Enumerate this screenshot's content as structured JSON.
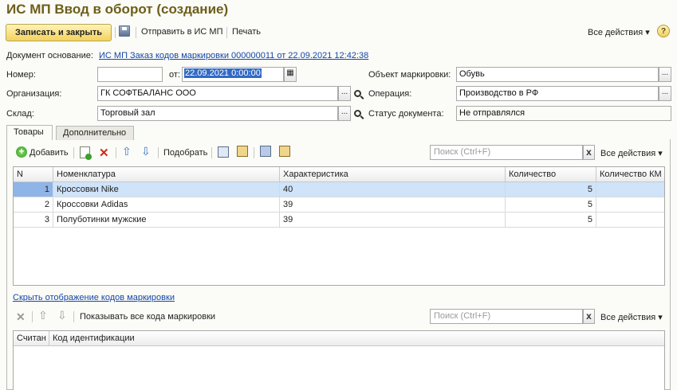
{
  "window": {
    "title": "ИС МП Ввод в оборот (создание)"
  },
  "toolbar": {
    "save_close": "Записать и закрыть",
    "send": "Отправить в ИС МП",
    "print": "Печать",
    "all_actions": "Все действия",
    "help": "?"
  },
  "header": {
    "basis_label": "Документ основание:",
    "basis_link": "ИС МП Заказ кодов маркировки 000000011 от 22.09.2021 12:42:38",
    "number_label": "Номер:",
    "number_value": "",
    "date_label": "от:",
    "date_value": "22.09.2021  0:00:00",
    "object_label": "Объект маркировки:",
    "object_value": "Обувь",
    "org_label": "Организация:",
    "org_value": "ГК СОФТБАЛАНС ООО",
    "operation_label": "Операция:",
    "operation_value": "Производство в РФ",
    "warehouse_label": "Склад:",
    "warehouse_value": "Торговый зал",
    "status_label": "Статус документа:",
    "status_value": "Не отправлялся",
    "select_glyph": "..."
  },
  "tabs": [
    {
      "label": "Товары"
    },
    {
      "label": "Дополнительно"
    }
  ],
  "goods": {
    "add": "Добавить",
    "pick": "Подобрать",
    "search_placeholder": "Поиск (Ctrl+F)",
    "clear": "x",
    "all_actions": "Все действия",
    "columns": [
      "N",
      "Номенклатура",
      "Характеристика",
      "Количество",
      "Количество КМ"
    ],
    "rows": [
      {
        "n": "1",
        "name": "Кроссовки Nike",
        "char": "40",
        "qty": "5",
        "km": ""
      },
      {
        "n": "2",
        "name": "Кроссовки Adidas",
        "char": "39",
        "qty": "5",
        "km": ""
      },
      {
        "n": "3",
        "name": "Полуботинки мужские",
        "char": "39",
        "qty": "5",
        "km": ""
      }
    ]
  },
  "codes": {
    "hide_link": "Скрыть отображение кодов маркировки",
    "show_all": "Показывать все кода маркировки",
    "search_placeholder": "Поиск (Ctrl+F)",
    "clear": "x",
    "all_actions": "Все действия",
    "columns": [
      "Считан",
      "Код идентификации"
    ]
  },
  "colors": {
    "accent": "#6d5e1a",
    "link": "#1447a8",
    "selection": "#cfe3f9"
  }
}
